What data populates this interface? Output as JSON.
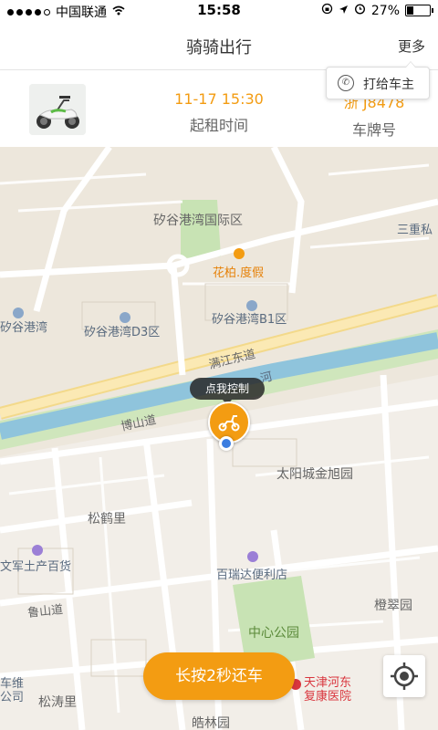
{
  "status_bar": {
    "carrier": "中国联通",
    "time": "15:58",
    "battery": "27%",
    "signal_icon": "signal-dots-icon",
    "wifi_icon": "wifi-icon",
    "location_icon": "location-arrow-icon",
    "alarm_icon": "alarm-icon",
    "lock_icon": "rotation-lock-icon"
  },
  "nav": {
    "title": "骑骑出行",
    "more_label": "更多"
  },
  "rental": {
    "time_value": "11-17 15:30",
    "time_label": "起租时间",
    "plate_value": "浙 J8478",
    "plate_label": "车牌号"
  },
  "call_owner": {
    "label": "打给车主",
    "icon": "phone-icon"
  },
  "map": {
    "labels": {
      "l1": "矽谷港湾国际区",
      "l2": "花柏.度假",
      "l3": "三重私",
      "l4": "矽谷港湾",
      "l5": "矽谷港湾D3区",
      "l6": "矽谷港湾B1区",
      "l7": "满江东道",
      "l8": "河",
      "l9": "博山道",
      "l10": "太阳城金旭园",
      "l11": "松鹤里",
      "l12": "文军土产百货",
      "l13": "百瑞达便利店",
      "l14": "鲁山道",
      "l15": "橙翠园",
      "l16": "中心公园",
      "l17": "车维",
      "l18": "公司",
      "l19": "松涛里",
      "l20": "天津河东",
      "l21": "复康医院",
      "l22": "皓林园"
    },
    "tooltip": "点我控制"
  },
  "actions": {
    "return_label": "长按2秒还车"
  },
  "colors": {
    "accent": "#f39c12",
    "map_bg": "#ede7dc",
    "river": "#8fc4dc",
    "green": "#c8e3b4",
    "road": "#ffffff",
    "highway": "#fbe6a4"
  }
}
